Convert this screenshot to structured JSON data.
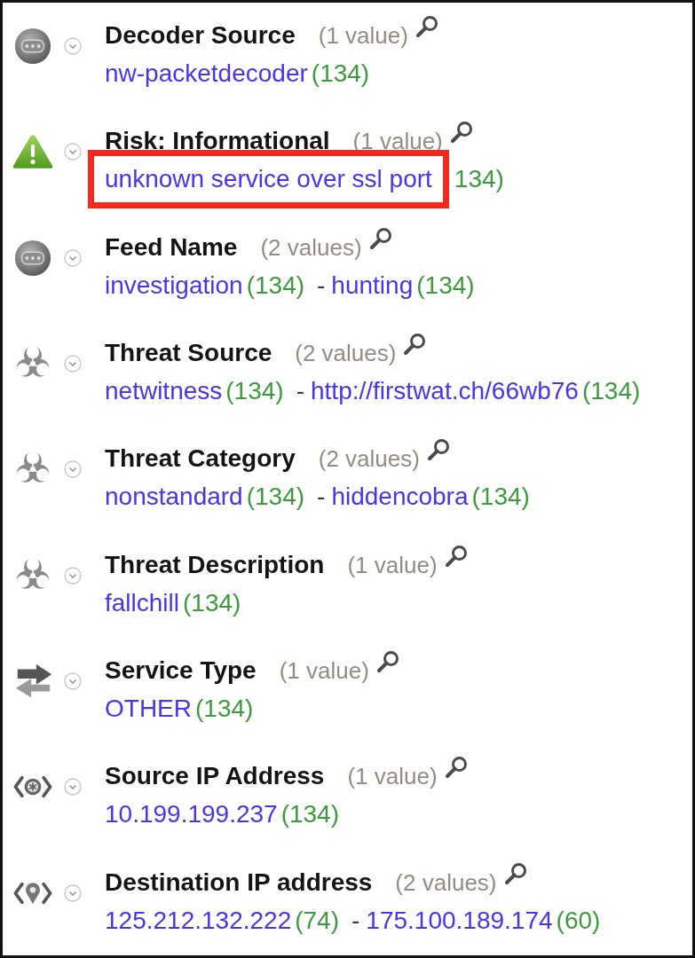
{
  "sections": [
    {
      "kind": "feed",
      "title": "Decoder Source",
      "count": "(1 value)",
      "values": [
        {
          "text": "nw-packetdecoder",
          "count": "(134)",
          "highlighted": false
        }
      ]
    },
    {
      "kind": "risk",
      "title": "Risk: Informational",
      "count": "(1 value)",
      "values": [
        {
          "text": "unknown service over ssl port",
          "count": "134)",
          "highlighted": true
        }
      ]
    },
    {
      "kind": "feed",
      "title": "Feed Name",
      "count": "(2 values)",
      "values": [
        {
          "text": "investigation",
          "count": "(134)",
          "highlighted": false
        },
        {
          "separator": "-",
          "text": "hunting",
          "count": "(134)",
          "highlighted": false
        }
      ]
    },
    {
      "kind": "threat",
      "title": "Threat Source",
      "count": "(2 values)",
      "values": [
        {
          "text": "netwitness",
          "count": "(134)",
          "highlighted": false
        },
        {
          "separator": "-",
          "text": "http://firstwat.ch/66wb76",
          "count": "(134)",
          "highlighted": false
        }
      ]
    },
    {
      "kind": "threat",
      "title": "Threat Category",
      "count": "(2 values)",
      "values": [
        {
          "text": "nonstandard",
          "count": "(134)",
          "highlighted": false
        },
        {
          "separator": "-",
          "text": "hiddencobra",
          "count": "(134)",
          "highlighted": false
        }
      ]
    },
    {
      "kind": "threat",
      "title": "Threat Description",
      "count": "(1 value)",
      "values": [
        {
          "text": "fallchill",
          "count": "(134)",
          "highlighted": false
        }
      ]
    },
    {
      "kind": "service",
      "title": "Service Type",
      "count": "(1 value)",
      "values": [
        {
          "text": "OTHER",
          "count": "(134)",
          "highlighted": false
        }
      ]
    },
    {
      "kind": "source",
      "title": "Source IP Address",
      "count": "(1 value)",
      "values": [
        {
          "text": "10.199.199.237",
          "count": "(134)",
          "highlighted": false
        }
      ]
    },
    {
      "kind": "destination",
      "title": "Destination IP address",
      "count": "(2 values)",
      "values": [
        {
          "text": "125.212.132.222",
          "count": "(74)",
          "highlighted": false
        },
        {
          "separator": "-",
          "text": "175.100.189.174",
          "count": "(60)",
          "highlighted": false
        }
      ]
    }
  ]
}
